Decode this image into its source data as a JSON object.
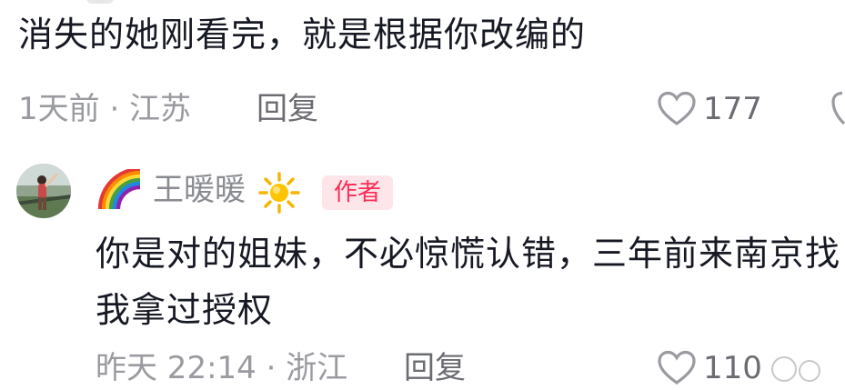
{
  "comments": [
    {
      "text": "消失的她刚看完，就是根据你改编的",
      "time_location": "1天前 · 江苏",
      "reply_label": "回复",
      "likes": "177"
    },
    {
      "username": "王暖暖",
      "username_prefix_emoji": "🌈",
      "username_suffix_emoji": "☀️",
      "badge": "作者",
      "text": "你是对的姐妹，不必惊慌认错，三年前来南京找我拿过授权",
      "time_location": "昨天 22:14 · 浙江",
      "reply_label": "回复",
      "likes": "110"
    }
  ],
  "colors": {
    "badge_bg": "#fde5ea",
    "badge_text": "#fe2c55",
    "meta_text": "#9a9ba0",
    "main_text": "#161823"
  },
  "icons": [
    "heart-outline-icon",
    "rainbow-emoji-icon",
    "sun-emoji-icon",
    "avatar-photo"
  ]
}
